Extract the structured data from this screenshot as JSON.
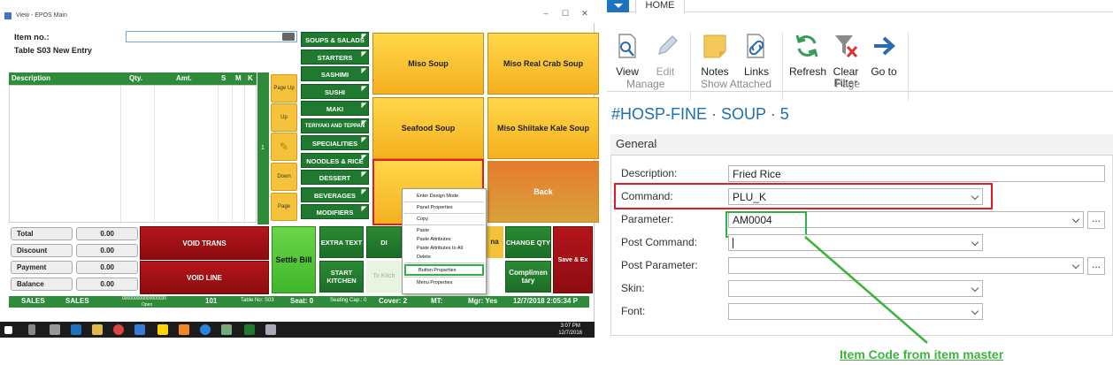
{
  "epos": {
    "window_title": "View - EPOS Main",
    "window_controls": [
      "–",
      "☐",
      "✕"
    ],
    "item_no_label": "Item no.:",
    "table_label": "Table S03 New Entry",
    "grid_headers": {
      "description": "Description",
      "qty": "Qty.",
      "amt": "Amt.",
      "s": "S",
      "m": "M",
      "k": "K"
    },
    "strip_text": "1",
    "nav_buttons": [
      "Page Up",
      "Up",
      "",
      "Down",
      "Page Down"
    ],
    "categories": [
      "SOUPS & SALADS",
      "STARTERS",
      "SASHIMI",
      "SUSHI",
      "MAKI",
      "TERIYAKI AND TEPPAN",
      "SPECIALITIES",
      "NOODLES & RICE",
      "DESSERT",
      "BEVERAGES",
      "MODIFIERS"
    ],
    "tiles": [
      "Miso Soup",
      "Miso Real Crab Soup",
      "Seafood Soup",
      "Miso Shiitake Kale Soup",
      "",
      "Back"
    ],
    "totals": [
      {
        "label": "Total",
        "value": "0.00"
      },
      {
        "label": "Discount",
        "value": "0.00"
      },
      {
        "label": "Payment",
        "value": "0.00"
      },
      {
        "label": "Balance",
        "value": "0.00"
      }
    ],
    "void_trans": "VOID TRANS",
    "void_line": "VOID LINE",
    "settle_bill": "Settle Bill",
    "extra_text": "EXTRA TEXT",
    "start_kitchen": "START KITCHEN",
    "di_partial": "DI",
    "to_kitchen": "To Kitch",
    "ma_partial": "na",
    "change_qty": "CHANGE QTY",
    "complimentary": "Complimen tary",
    "save_ex": "Save & Ex",
    "context_menu": [
      "Enter Design Mode",
      "Panel Properties",
      "Copy",
      "Paste",
      "Paste Attributes",
      "Paste Attributes to All",
      "Delete",
      "Button Properties",
      "Menu Properties"
    ],
    "status": {
      "sales1": "SALES",
      "sales2": "SALES",
      "code": "000000000000000030",
      "open": "Open",
      "num": "101",
      "table": "Table No: S03",
      "seat": "Seat: 0",
      "seating": "Seating Cap.: 0",
      "cover": "Cover: 2",
      "mt": "MT:",
      "mgr": "Mgr: Yes",
      "datetime": "12/7/2018 2:05:34 P"
    },
    "taskbar_time": "3:07 PM",
    "taskbar_date": "12/7/2018"
  },
  "nav": {
    "tab_home": "HOME",
    "actions": [
      {
        "label": "View",
        "icon": "view-icon",
        "disabled": false
      },
      {
        "label": "Edit",
        "icon": "edit-icon",
        "disabled": true
      },
      {
        "label": "Notes",
        "icon": "notes-icon",
        "disabled": false
      },
      {
        "label": "Links",
        "icon": "links-icon",
        "disabled": false
      },
      {
        "label": "Refresh",
        "icon": "refresh-icon",
        "disabled": false
      },
      {
        "label": "Clear Filter",
        "icon": "clear-filter-icon",
        "disabled": false
      },
      {
        "label": "Go to",
        "icon": "goto-icon",
        "disabled": false
      }
    ],
    "groups": [
      "Manage",
      "Show Attached",
      "Page"
    ],
    "page_title": "#HOSP-FINE · SOUP · 5",
    "section": "General",
    "fields": [
      {
        "label": "Description:",
        "value": "Fried Rice"
      },
      {
        "label": "Command:",
        "value": "PLU_K"
      },
      {
        "label": "Parameter:",
        "value": "AM0004"
      },
      {
        "label": "Post Command:",
        "value": ""
      },
      {
        "label": "Post Parameter:",
        "value": ""
      },
      {
        "label": "Skin:",
        "value": ""
      },
      {
        "label": "Font:",
        "value": ""
      }
    ],
    "lookup_label": "..."
  },
  "annotation": "Item Code from item master",
  "colors": {
    "nav_blue": "#1b6fb3",
    "highlight_red": "#e31b23",
    "highlight_green": "#2db34a",
    "epos_green": "#2e8b3a",
    "tile_yellow": "#f5b01f"
  }
}
